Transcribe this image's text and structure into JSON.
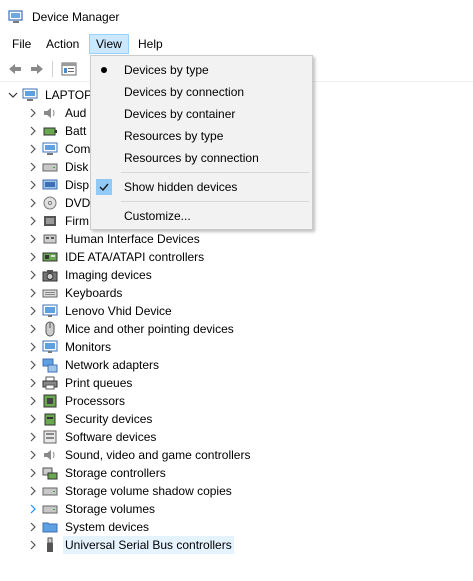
{
  "window": {
    "title": "Device Manager"
  },
  "menu": {
    "file": "File",
    "action": "Action",
    "view": "View",
    "help": "Help"
  },
  "view_menu": {
    "items": [
      {
        "label": "Devices by type",
        "checked": "bullet"
      },
      {
        "label": "Devices by connection"
      },
      {
        "label": "Devices by container"
      },
      {
        "label": "Resources by type"
      },
      {
        "label": "Resources by connection"
      },
      {
        "label": "Show hidden devices",
        "checked": "check"
      },
      {
        "label": "Customize..."
      }
    ]
  },
  "tree": {
    "root_label": "LAPTOP",
    "nodes": [
      {
        "label": "Aud",
        "icon": "speaker-icon"
      },
      {
        "label": "Batt",
        "icon": "battery-icon"
      },
      {
        "label": "Com",
        "icon": "computer-icon"
      },
      {
        "label": "Disk",
        "icon": "disk-drive-icon"
      },
      {
        "label": "Disp",
        "icon": "display-adapter-icon"
      },
      {
        "label": "DVD",
        "icon": "dvd-icon"
      },
      {
        "label": "Firm",
        "icon": "firmware-icon"
      },
      {
        "label": "Human Interface Devices",
        "icon": "hid-icon"
      },
      {
        "label": "IDE ATA/ATAPI controllers",
        "icon": "ide-controller-icon"
      },
      {
        "label": "Imaging devices",
        "icon": "camera-icon"
      },
      {
        "label": "Keyboards",
        "icon": "keyboard-icon"
      },
      {
        "label": "Lenovo Vhid Device",
        "icon": "monitor-icon"
      },
      {
        "label": "Mice and other pointing devices",
        "icon": "mouse-icon"
      },
      {
        "label": "Monitors",
        "icon": "monitor-icon"
      },
      {
        "label": "Network adapters",
        "icon": "network-icon"
      },
      {
        "label": "Print queues",
        "icon": "printer-icon"
      },
      {
        "label": "Processors",
        "icon": "processor-icon"
      },
      {
        "label": "Security devices",
        "icon": "security-device-icon"
      },
      {
        "label": "Software devices",
        "icon": "software-device-icon"
      },
      {
        "label": "Sound, video and game controllers",
        "icon": "speaker-icon"
      },
      {
        "label": "Storage controllers",
        "icon": "storage-controller-icon"
      },
      {
        "label": "Storage volume shadow copies",
        "icon": "disk-drive-icon"
      },
      {
        "label": "Storage volumes",
        "icon": "disk-drive-icon"
      },
      {
        "label": "System devices",
        "icon": "system-folder-icon"
      },
      {
        "label": "Universal Serial Bus controllers",
        "icon": "usb-icon",
        "selected": true
      }
    ]
  },
  "colors": {
    "menu_highlight": "#cce8ff",
    "check_box": "#91c9f7",
    "selection": "#e5f3ff",
    "chevron_hover": "#1e90ff"
  }
}
